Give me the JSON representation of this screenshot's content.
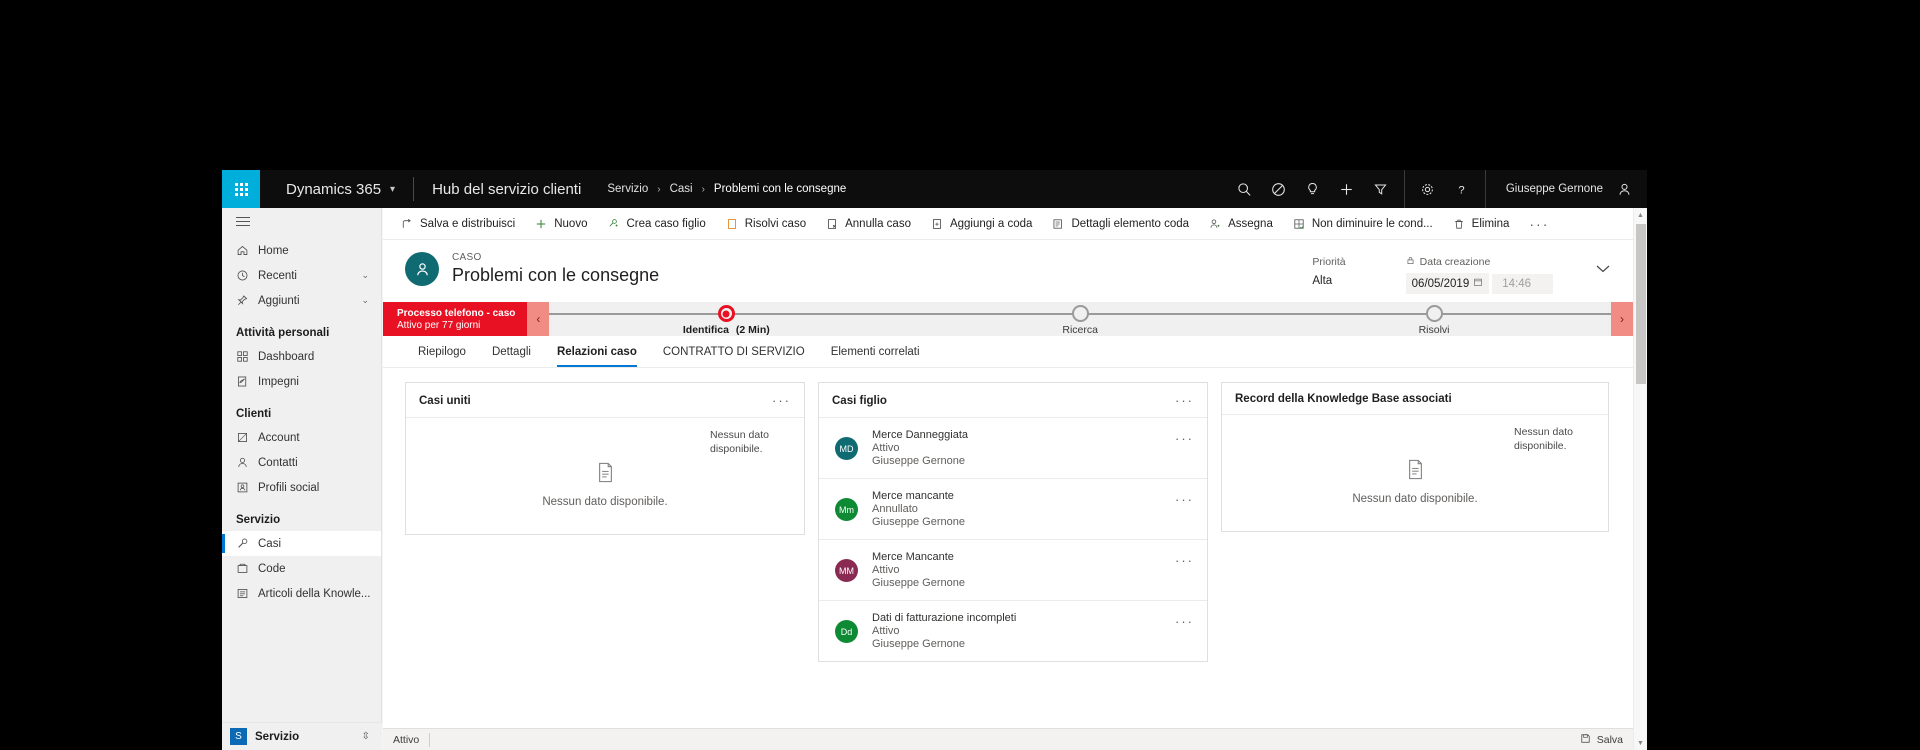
{
  "topbar": {
    "waffle_label": "app-launcher",
    "brand": "Dynamics 365",
    "app_title": "Hub del servizio clienti",
    "breadcrumbs": [
      "Servizio",
      "Casi",
      "Problemi con le consegne"
    ],
    "separator": "›",
    "user_name": "Giuseppe Gernone",
    "icons": [
      "search-icon",
      "assistant-icon",
      "insights-icon",
      "quick-create-icon",
      "filter-icon",
      "settings-icon",
      "help-icon"
    ]
  },
  "sidebar": {
    "top_items": [
      {
        "label": "Home",
        "icon": "home-icon",
        "chevron": ""
      },
      {
        "label": "Recenti",
        "icon": "clock-icon",
        "chevron": "⌄"
      },
      {
        "label": "Aggiunti",
        "icon": "pin-icon",
        "chevron": "⌄"
      }
    ],
    "groups": [
      {
        "title": "Attività personali",
        "items": [
          {
            "label": "Dashboard",
            "icon": "dashboard-icon"
          },
          {
            "label": "Impegni",
            "icon": "activities-icon"
          }
        ]
      },
      {
        "title": "Clienti",
        "items": [
          {
            "label": "Account",
            "icon": "account-icon"
          },
          {
            "label": "Contatti",
            "icon": "contact-icon"
          },
          {
            "label": "Profili social",
            "icon": "social-profile-icon"
          }
        ]
      },
      {
        "title": "Servizio",
        "items": [
          {
            "label": "Casi",
            "icon": "case-icon",
            "selected": true
          },
          {
            "label": "Code",
            "icon": "queue-icon"
          },
          {
            "label": "Articoli della Knowle...",
            "icon": "knowledge-article-icon"
          }
        ]
      }
    ],
    "footer": {
      "badge": "S",
      "label": "Servizio",
      "chevron": "⌃⌄"
    }
  },
  "command_bar": {
    "commands": [
      {
        "label": "Salva e distribuisci",
        "icon": "save-and-route-icon"
      },
      {
        "label": "Nuovo",
        "icon": "plus-icon"
      },
      {
        "label": "Crea caso figlio",
        "icon": "child-case-icon"
      },
      {
        "label": "Risolvi caso",
        "icon": "resolve-case-icon"
      },
      {
        "label": "Annulla caso",
        "icon": "cancel-case-icon"
      },
      {
        "label": "Aggiungi a coda",
        "icon": "add-to-queue-icon"
      },
      {
        "label": "Dettagli elemento coda",
        "icon": "queue-item-details-icon"
      },
      {
        "label": "Assegna",
        "icon": "assign-icon"
      },
      {
        "label": "Non diminuire le cond...",
        "icon": "do-not-decrement-icon"
      },
      {
        "label": "Elimina",
        "icon": "delete-icon"
      }
    ],
    "overflow": "···"
  },
  "record_header": {
    "avatar_initial": "case-avatar-icon",
    "entity_label": "CASO",
    "title": "Problemi con le consegne",
    "fields": [
      {
        "label": "Priorità",
        "value": "Alta",
        "locked": false
      },
      {
        "label": "Data creazione",
        "value": "06/05/2019",
        "time": "14:46",
        "locked": true
      }
    ],
    "expand_chevron": "⌄"
  },
  "process_flow": {
    "stage_title": "Processo telefono - caso",
    "stage_subtitle": "Attivo per 77 giorni",
    "prev_arrow": "‹",
    "next_arrow": "›",
    "steps": [
      {
        "label": "Identifica",
        "duration": "(2 Min)",
        "active": true
      },
      {
        "label": "Ricerca",
        "duration": "",
        "active": false
      },
      {
        "label": "Risolvi",
        "duration": "",
        "active": false
      }
    ]
  },
  "tabs": [
    {
      "label": "Riepilogo",
      "active": false
    },
    {
      "label": "Dettagli",
      "active": false
    },
    {
      "label": "Relazioni caso",
      "active": true
    },
    {
      "label": "CONTRATTO DI SERVIZIO",
      "active": false
    },
    {
      "label": "Elementi correlati",
      "active": false
    }
  ],
  "cards": {
    "merged_cases": {
      "title": "Casi uniti",
      "more": "···",
      "corner_note": "Nessun dato disponibile.",
      "empty_text": "Nessun dato disponibile.",
      "empty_icon": "document-icon"
    },
    "child_cases": {
      "title": "Casi figlio",
      "more": "···",
      "rows": [
        {
          "initials": "MD",
          "color": "#0f6a71",
          "name": "Merce Danneggiata",
          "status": "Attivo",
          "owner": "Giuseppe Gernone",
          "more": "···"
        },
        {
          "initials": "Mm",
          "color": "#0f8a34",
          "name": "Merce mancante",
          "status": "Annullato",
          "owner": "Giuseppe Gernone",
          "more": "···"
        },
        {
          "initials": "MM",
          "color": "#8a2a52",
          "name": "Merce Mancante",
          "status": "Attivo",
          "owner": "Giuseppe Gernone",
          "more": "···"
        },
        {
          "initials": "Dd",
          "color": "#0f8a34",
          "name": "Dati di fatturazione incompleti",
          "status": "Attivo",
          "owner": "Giuseppe Gernone",
          "more": "···"
        }
      ]
    },
    "kb_records": {
      "title": "Record della Knowledge Base associati",
      "corner_note": "Nessun dato disponibile.",
      "empty_text": "Nessun dato disponibile.",
      "empty_icon": "document-icon"
    }
  },
  "status_bar": {
    "state": "Attivo",
    "save_label": "Salva",
    "save_icon": "save-icon"
  },
  "colors": {
    "accent": "#0078d4",
    "brand_cyan": "#00aedb",
    "process_red": "#e81123",
    "teal": "#0f6a71",
    "topbar": "#0d0d0d"
  }
}
